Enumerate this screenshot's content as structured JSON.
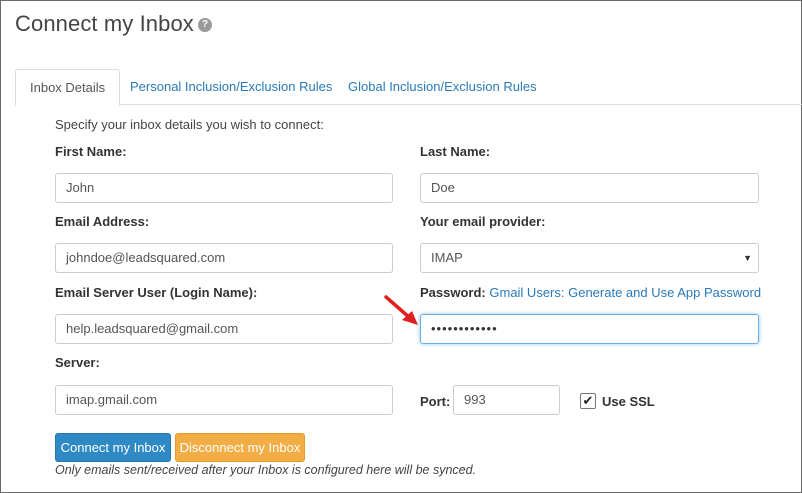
{
  "header": {
    "title": "Connect my Inbox",
    "help_icon": "?"
  },
  "tabs": [
    {
      "label": "Inbox Details",
      "active": true
    },
    {
      "label": "Personal Inclusion/Exclusion Rules",
      "active": false
    },
    {
      "label": "Global Inclusion/Exclusion Rules",
      "active": false
    }
  ],
  "form": {
    "intro": "Specify your inbox details you wish to connect:",
    "first_name": {
      "label": "First Name:",
      "value": "John"
    },
    "last_name": {
      "label": "Last Name:",
      "value": "Doe"
    },
    "email_address": {
      "label": "Email Address:",
      "value": "johndoe@leadsquared.com"
    },
    "email_provider": {
      "label": "Your email provider:",
      "value": "IMAP"
    },
    "server_user": {
      "label": "Email Server User (Login Name):",
      "value": "help.leadsquared@gmail.com"
    },
    "password": {
      "label": "Password:",
      "link": "Gmail Users: Generate and Use App Password",
      "value": "••••••••••••"
    },
    "server": {
      "label": "Server:",
      "value": "imap.gmail.com"
    },
    "port": {
      "label": "Port:",
      "value": "993"
    },
    "use_ssl": {
      "label": "Use SSL",
      "checked": true,
      "check_glyph": "✔"
    }
  },
  "buttons": {
    "connect": "Connect my Inbox",
    "disconnect": "Disconnect my Inbox"
  },
  "footnote": "Only emails sent/received after your Inbox is configured here will be synced.",
  "colors": {
    "primary": "#2e89c4",
    "warning": "#f3ad45",
    "link": "#2a7ab8",
    "arrow": "#e02020"
  }
}
